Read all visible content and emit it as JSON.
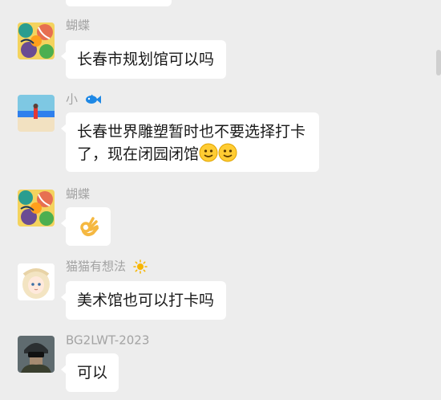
{
  "messages": [
    {
      "sender": "蝴蝶",
      "text": "长春市规划馆可以吗",
      "avatar": "butterfly-art-avatar"
    },
    {
      "sender": "小",
      "sender_badge": "fish-icon",
      "text_line1": "长春世界雕塑暂时也不要选择打卡",
      "text_line2": "了，现在闭园闭馆",
      "emoji": "smile-emoji",
      "avatar": "beach-photo-avatar"
    },
    {
      "sender": "蝴蝶",
      "emoji": "ok-hand-emoji",
      "avatar": "butterfly-art-avatar"
    },
    {
      "sender": "猫猫有想法",
      "sender_badge": "sun-icon",
      "text": "美术馆也可以打卡吗",
      "avatar": "anime-girl-avatar"
    },
    {
      "sender": "BG2LWT-2023",
      "text": "可以",
      "avatar": "soldier-avatar"
    }
  ],
  "colors": {
    "background": "#ededed",
    "bubble": "#ffffff",
    "name": "#a3a3a3",
    "text": "#191919"
  }
}
